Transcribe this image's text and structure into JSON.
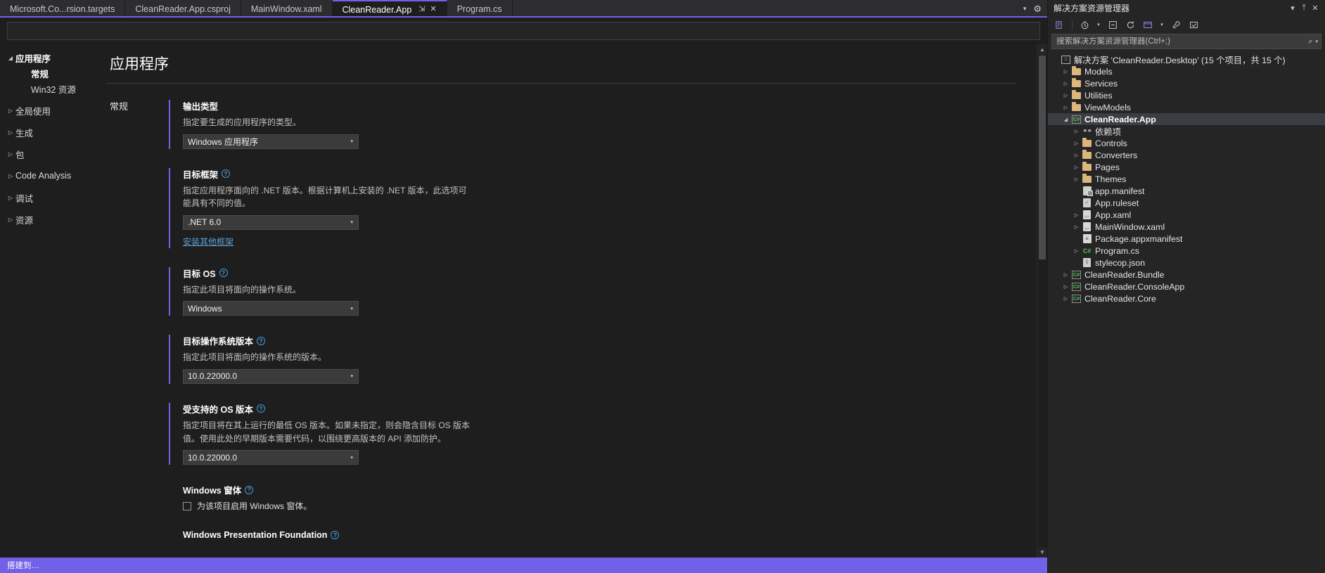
{
  "tabs": [
    {
      "label": "Microsoft.Co...rsion.targets",
      "active": false
    },
    {
      "label": "CleanReader.App.csproj",
      "active": false
    },
    {
      "label": "MainWindow.xaml",
      "active": false
    },
    {
      "label": "CleanReader.App",
      "active": true,
      "pin": "⇲",
      "close": "✕"
    },
    {
      "label": "Program.cs",
      "active": false
    }
  ],
  "tabstrip": {
    "overflow_caret": "▾",
    "settings_icon": "⚙"
  },
  "propnav": [
    {
      "label": "应用程序",
      "arrow": "◢",
      "level": "root"
    },
    {
      "label": "常规",
      "arrow": "",
      "level": "sub",
      "selected": true
    },
    {
      "label": "Win32 资源",
      "arrow": "",
      "level": "sub",
      "selected": false
    },
    {
      "label": "全局使用",
      "arrow": "▷",
      "level": "group"
    },
    {
      "label": "生成",
      "arrow": "▷",
      "level": "group"
    },
    {
      "label": "包",
      "arrow": "▷",
      "level": "group"
    },
    {
      "label": "Code Analysis",
      "arrow": "▷",
      "level": "group"
    },
    {
      "label": "调试",
      "arrow": "▷",
      "level": "group"
    },
    {
      "label": "资源",
      "arrow": "▷",
      "level": "group"
    }
  ],
  "page": {
    "title": "应用程序",
    "section_label": "常规",
    "help_glyph": "?",
    "dropdown_glyph": "▾"
  },
  "fields": [
    {
      "title": "输出类型",
      "help": false,
      "desc": "指定要生成的应用程序的类型。",
      "value": "Windows 应用程序"
    },
    {
      "title": "目标框架",
      "help": true,
      "desc": "指定应用程序面向的 .NET 版本。根据计算机上安装的 .NET 版本，此选项可能具有不同的值。",
      "value": ".NET 6.0",
      "link": "安装其他框架"
    },
    {
      "title": "目标 OS",
      "help": true,
      "desc": "指定此项目将面向的操作系统。",
      "value": "Windows"
    },
    {
      "title": "目标操作系统版本",
      "help": true,
      "desc": "指定此项目将面向的操作系统的版本。",
      "value": "10.0.22000.0"
    },
    {
      "title": "受支持的 OS 版本",
      "help": true,
      "desc": "指定项目将在其上运行的最低 OS 版本。如果未指定，则会隐含目标 OS 版本值。使用此处的早期版本需要代码，以围绕更高版本的 API 添加防护。",
      "value": "10.0.22000.0",
      "desc_wide": true
    }
  ],
  "winforms": {
    "title": "Windows 窗体",
    "checkbox_label": "为该项目启用 Windows 窗体。",
    "checked": false
  },
  "wpf": {
    "title": "Windows Presentation Foundation"
  },
  "statusbar": {
    "text": "搭建到…"
  },
  "solution_explorer": {
    "title": "解决方案资源管理器",
    "header_buttons": {
      "dropdown": "▾",
      "pin": "⤒",
      "close": "✕"
    },
    "toolbar": [
      {
        "name": "home-view-icon",
        "glyph": "⬚"
      },
      {
        "name": "pending-changes-icon",
        "glyph": "◴"
      },
      {
        "name": "toolbar-caret-icon",
        "glyph": "▾"
      },
      {
        "name": "collapse-all-icon",
        "glyph": "☰"
      },
      {
        "name": "refresh-icon",
        "glyph": "↻"
      },
      {
        "name": "show-all-files-icon",
        "glyph": "❐"
      },
      {
        "name": "view-caret-icon",
        "glyph": "▾"
      },
      {
        "name": "properties-icon",
        "glyph": "ὒ7"
      },
      {
        "name": "preview-icon",
        "glyph": "⤧"
      }
    ],
    "search": {
      "placeholder": "搜索解决方案资源管理器(Ctrl+;)",
      "value": "",
      "icon": "⌕",
      "caret": "▾"
    },
    "tree": [
      {
        "label": "解决方案 'CleanReader.Desktop' (15 个项目，共 15 个)",
        "indent": 0,
        "twist": "",
        "icon": "sln",
        "selected": false
      },
      {
        "label": "Models",
        "indent": 1,
        "twist": "▷",
        "icon": "folder",
        "selected": false
      },
      {
        "label": "Services",
        "indent": 1,
        "twist": "▷",
        "icon": "folder",
        "selected": false
      },
      {
        "label": "Utilities",
        "indent": 1,
        "twist": "▷",
        "icon": "folder",
        "selected": false
      },
      {
        "label": "ViewModels",
        "indent": 1,
        "twist": "▷",
        "icon": "folder",
        "selected": false
      },
      {
        "label": "CleanReader.App",
        "indent": 1,
        "twist": "◢",
        "icon": "csproj",
        "selected": true
      },
      {
        "label": "依赖项",
        "indent": 2,
        "twist": "▷",
        "icon": "dep",
        "selected": false
      },
      {
        "label": "Controls",
        "indent": 2,
        "twist": "▷",
        "icon": "folder",
        "selected": false
      },
      {
        "label": "Converters",
        "indent": 2,
        "twist": "▷",
        "icon": "folder",
        "selected": false
      },
      {
        "label": "Pages",
        "indent": 2,
        "twist": "▷",
        "icon": "folder",
        "selected": false
      },
      {
        "label": "Themes",
        "indent": 2,
        "twist": "▷",
        "icon": "folder",
        "selected": false
      },
      {
        "label": "app.manifest",
        "indent": 2,
        "twist": "",
        "icon": "manifest",
        "selected": false
      },
      {
        "label": "App.ruleset",
        "indent": 2,
        "twist": "",
        "icon": "ruleset",
        "selected": false
      },
      {
        "label": "App.xaml",
        "indent": 2,
        "twist": "▷",
        "icon": "xaml",
        "selected": false
      },
      {
        "label": "MainWindow.xaml",
        "indent": 2,
        "twist": "▷",
        "icon": "xaml",
        "selected": false
      },
      {
        "label": "Package.appxmanifest",
        "indent": 2,
        "twist": "",
        "icon": "appx",
        "selected": false
      },
      {
        "label": "Program.cs",
        "indent": 2,
        "twist": "▷",
        "icon": "cs",
        "selected": false
      },
      {
        "label": "stylecop.json",
        "indent": 2,
        "twist": "",
        "icon": "json",
        "selected": false
      },
      {
        "label": "CleanReader.Bundle",
        "indent": 1,
        "twist": "▷",
        "icon": "csproj",
        "selected": false
      },
      {
        "label": "CleanReader.ConsoleApp",
        "indent": 1,
        "twist": "▷",
        "icon": "csproj",
        "selected": false
      },
      {
        "label": "CleanReader.Core",
        "indent": 1,
        "twist": "▷",
        "icon": "csproj",
        "selected": false
      }
    ]
  },
  "colors": {
    "accent": "#7160e8",
    "background": "#1e1e1e",
    "panel": "#252526",
    "link": "#5a9fd4",
    "folder": "#dcb67a"
  }
}
